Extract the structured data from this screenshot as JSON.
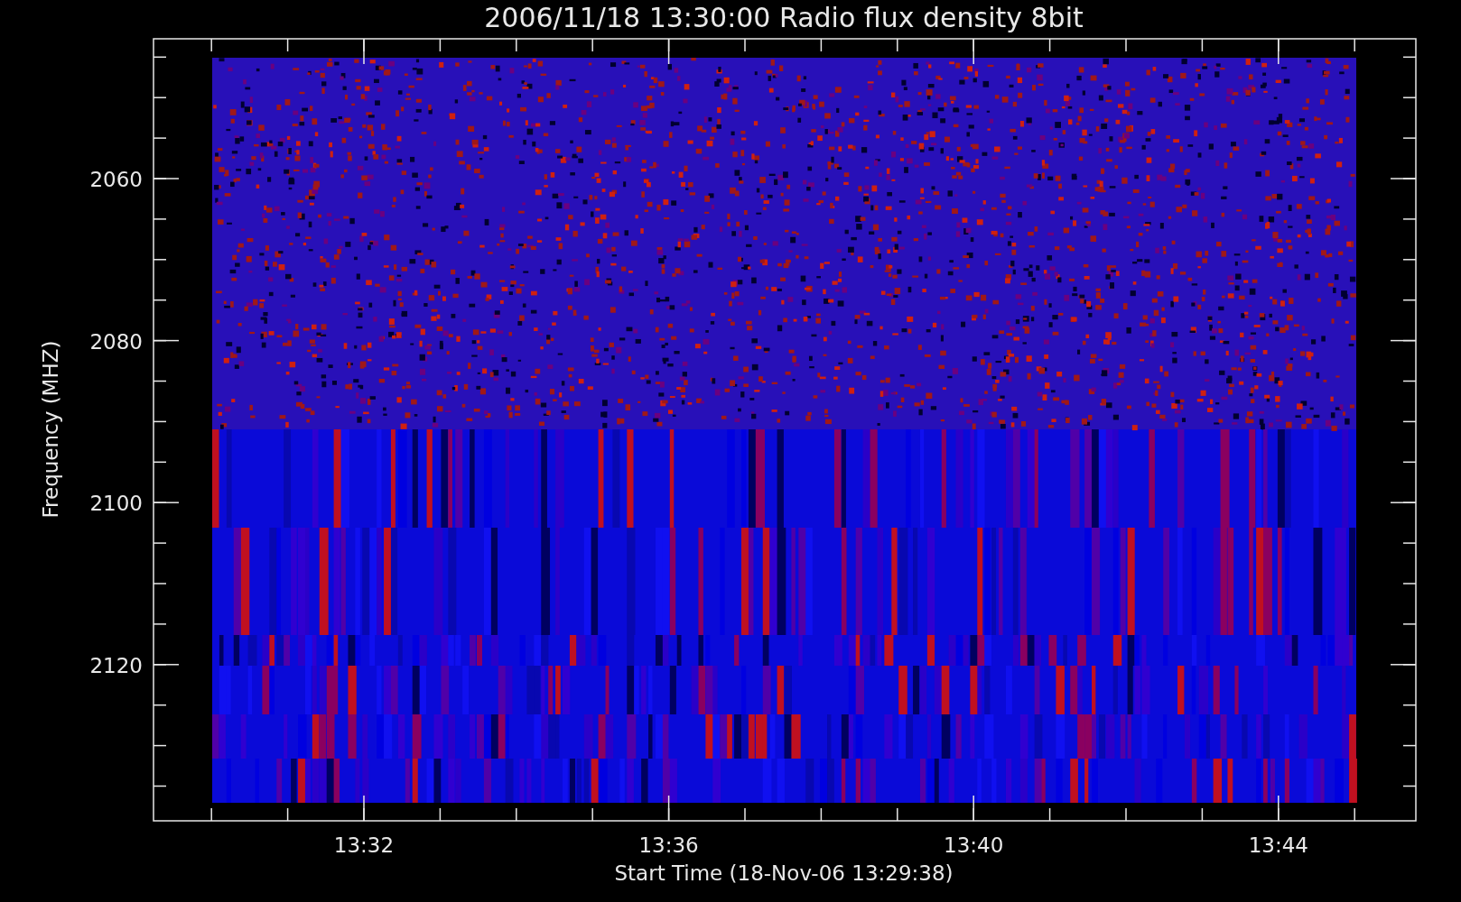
{
  "title": "2006/11/18 13:30:00 Radio flux density 8bit",
  "y_axis": {
    "label": "Frequency (MHZ)",
    "ticks": [
      "2060",
      "2080",
      "2100",
      "2120"
    ]
  },
  "x_axis": {
    "label": "Start Time (18-Nov-06 13:29:38)",
    "ticks": [
      "13:32",
      "13:36",
      "13:40",
      "13:44"
    ]
  }
}
